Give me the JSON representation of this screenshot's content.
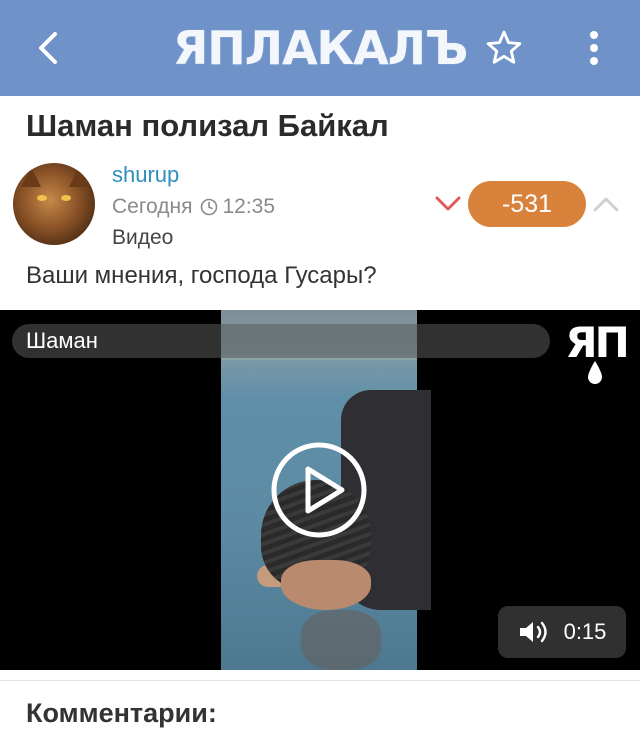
{
  "header": {
    "logo_text": "ЯПЛАКАЛЪ",
    "back_icon": "chevron-left-icon",
    "favorite_icon": "star-icon",
    "menu_icon": "more-vertical-icon",
    "background_color": "#6f93c9"
  },
  "post": {
    "title": "Шаман полизал Байкал",
    "author": "shurup",
    "date": "Сегодня",
    "time": "12:35",
    "category": "Видео",
    "rating": "-531",
    "rating_color": "#d9823b",
    "text": "Ваши мнения, господа Гусары?"
  },
  "video": {
    "title": "Шаман",
    "duration": "0:15",
    "watermark": "ЯП"
  },
  "comments": {
    "heading": "Комментарии:"
  }
}
